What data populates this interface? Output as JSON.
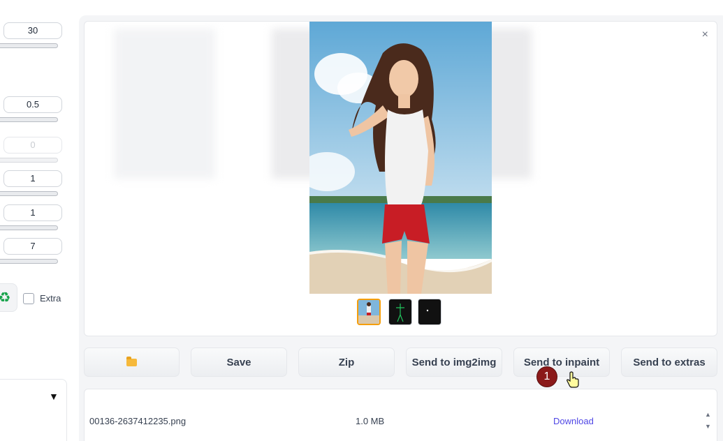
{
  "settings": {
    "steps_value": "30",
    "denoise_value": "0.5",
    "dim_value": "0",
    "batch_count_value": "1",
    "batch_size_value": "1",
    "cfg_value": "7",
    "extra_label": "Extra"
  },
  "gallery": {
    "close_symbol": "×",
    "thumbnails": [
      "result-image",
      "openpose-preview",
      "mask-preview"
    ]
  },
  "actions": {
    "save": "Save",
    "zip": "Zip",
    "send_img2img": "Send to img2img",
    "send_inpaint": "Send to inpaint",
    "send_extras": "Send to extras"
  },
  "file": {
    "name": "00136-2637412235.png",
    "size": "1.0 MB",
    "download_label": "Download"
  },
  "annotation": {
    "step_number": "1"
  },
  "colors": {
    "accent_orange": "#f59e0b",
    "link": "#4f46e5",
    "badge": "#8b1a1a"
  }
}
